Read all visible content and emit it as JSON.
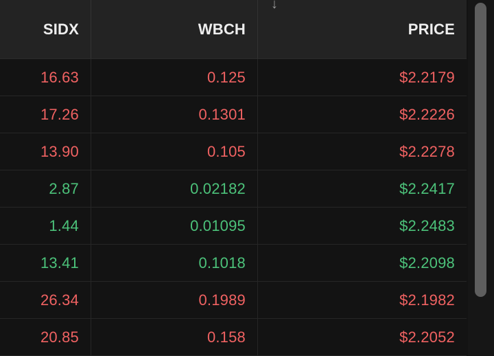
{
  "columns": {
    "col1": "SIDX",
    "col2": "WBCH",
    "col3": "PRICE"
  },
  "sort_icon": "arrow-down-icon",
  "colors": {
    "negative": "#f06262",
    "positive": "#4cc27a"
  },
  "rows": [
    {
      "sidx": "16.63",
      "wbch": "0.125",
      "price": "$2.2179",
      "direction": "negative"
    },
    {
      "sidx": "17.26",
      "wbch": "0.1301",
      "price": "$2.2226",
      "direction": "negative"
    },
    {
      "sidx": "13.90",
      "wbch": "0.105",
      "price": "$2.2278",
      "direction": "negative"
    },
    {
      "sidx": "2.87",
      "wbch": "0.02182",
      "price": "$2.2417",
      "direction": "positive"
    },
    {
      "sidx": "1.44",
      "wbch": "0.01095",
      "price": "$2.2483",
      "direction": "positive"
    },
    {
      "sidx": "13.41",
      "wbch": "0.1018",
      "price": "$2.2098",
      "direction": "positive"
    },
    {
      "sidx": "26.34",
      "wbch": "0.1989",
      "price": "$2.1982",
      "direction": "negative"
    },
    {
      "sidx": "20.85",
      "wbch": "0.158",
      "price": "$2.2052",
      "direction": "negative"
    }
  ]
}
